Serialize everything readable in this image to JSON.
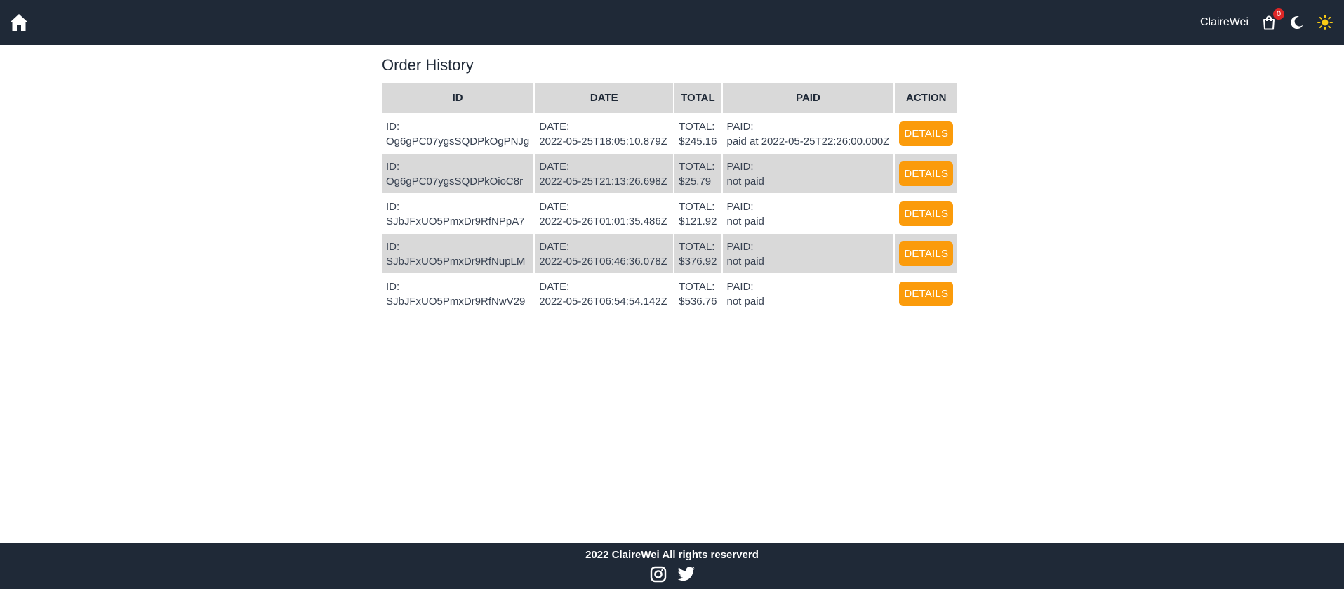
{
  "header": {
    "home_icon": "home-icon",
    "username": "ClaireWei",
    "cart_icon": "shopping-bag-icon",
    "cart_count": "0",
    "moon_icon": "moon-icon",
    "sun_icon": "sun-icon",
    "colors": {
      "bar": "#1f2937",
      "badge": "#dc2626",
      "sun": "#facc15"
    }
  },
  "main": {
    "title": "Order History",
    "columns": [
      "ID",
      "DATE",
      "TOTAL",
      "PAID",
      "ACTION"
    ],
    "rows": [
      {
        "id_label": "ID:",
        "id": "Og6gPC07ygsSQDPkOgPNJg",
        "date_label": "DATE:",
        "date": "2022-05-25T18:05:10.879Z",
        "total_label": "TOTAL:",
        "total": "$245.16",
        "paid_label": "PAID:",
        "paid": "paid at 2022-05-25T22:26:00.000Z",
        "action": "DETAILS"
      },
      {
        "id_label": "ID:",
        "id": "Og6gPC07ygsSQDPkOioC8r",
        "date_label": "DATE:",
        "date": "2022-05-25T21:13:26.698Z",
        "total_label": "TOTAL:",
        "total": "$25.79",
        "paid_label": "PAID:",
        "paid": "not paid",
        "action": "DETAILS"
      },
      {
        "id_label": "ID:",
        "id": "SJbJFxUO5PmxDr9RfNPpA7",
        "date_label": "DATE:",
        "date": "2022-05-26T01:01:35.486Z",
        "total_label": "TOTAL:",
        "total": "$121.92",
        "paid_label": "PAID:",
        "paid": "not paid",
        "action": "DETAILS"
      },
      {
        "id_label": "ID:",
        "id": "SJbJFxUO5PmxDr9RfNupLM",
        "date_label": "DATE:",
        "date": "2022-05-26T06:46:36.078Z",
        "total_label": "TOTAL:",
        "total": "$376.92",
        "paid_label": "PAID:",
        "paid": "not paid",
        "action": "DETAILS"
      },
      {
        "id_label": "ID:",
        "id": "SJbJFxUO5PmxDr9RfNwV29",
        "date_label": "DATE:",
        "date": "2022-05-26T06:54:54.142Z",
        "total_label": "TOTAL:",
        "total": "$536.76",
        "paid_label": "PAID:",
        "paid": "not paid",
        "action": "DETAILS"
      }
    ],
    "colors": {
      "header_bg": "#d9d9d9",
      "button": "#fb9b0b"
    }
  },
  "footer": {
    "text": "2022 ClaireWei All rights reserverd",
    "instagram_icon": "instagram-icon",
    "twitter_icon": "twitter-icon"
  }
}
